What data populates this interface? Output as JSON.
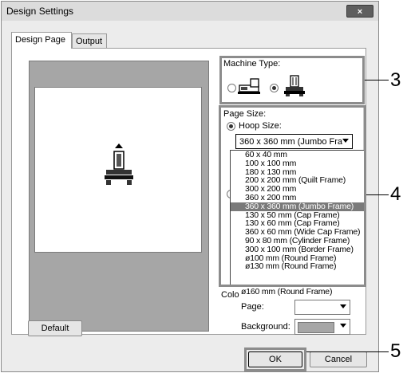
{
  "window": {
    "title": "Design Settings",
    "close_label": "×"
  },
  "tabs": [
    {
      "label": "Design Page"
    },
    {
      "label": "Output"
    }
  ],
  "machine_type": {
    "label": "Machine Type:"
  },
  "page_size": {
    "label": "Page Size:",
    "hoop_label": "Hoop Size:",
    "hoop_selected": "360 x 360 mm (Jumbo Fra",
    "options": [
      "60 x 40 mm",
      "100 x 100 mm",
      "180 x 130 mm",
      "200 x 200 mm (Quilt Frame)",
      "300 x 200 mm",
      "360 x 200 mm",
      "360 x 360 mm (Jumbo Frame)",
      "130 x 50 mm (Cap Frame)",
      "130 x 60 mm (Cap Frame)",
      "360 x 60 mm (Wide Cap Frame)",
      "90 x 80 mm (Cylinder Frame)",
      "300 x 100 mm (Border Frame)",
      "ø100 mm (Round Frame)",
      "ø130 mm (Round Frame)"
    ],
    "selected_index": 6,
    "trailing_option": "ø160 mm (Round Frame)"
  },
  "color": {
    "label_partial": "Colo",
    "page_label": "Page:",
    "background_label": "Background:",
    "background_swatch": "#a6a6a6"
  },
  "buttons": {
    "default": "Default",
    "ok": "OK",
    "cancel": "Cancel"
  },
  "callouts": {
    "c3": "3",
    "c4": "4",
    "c5": "5"
  }
}
